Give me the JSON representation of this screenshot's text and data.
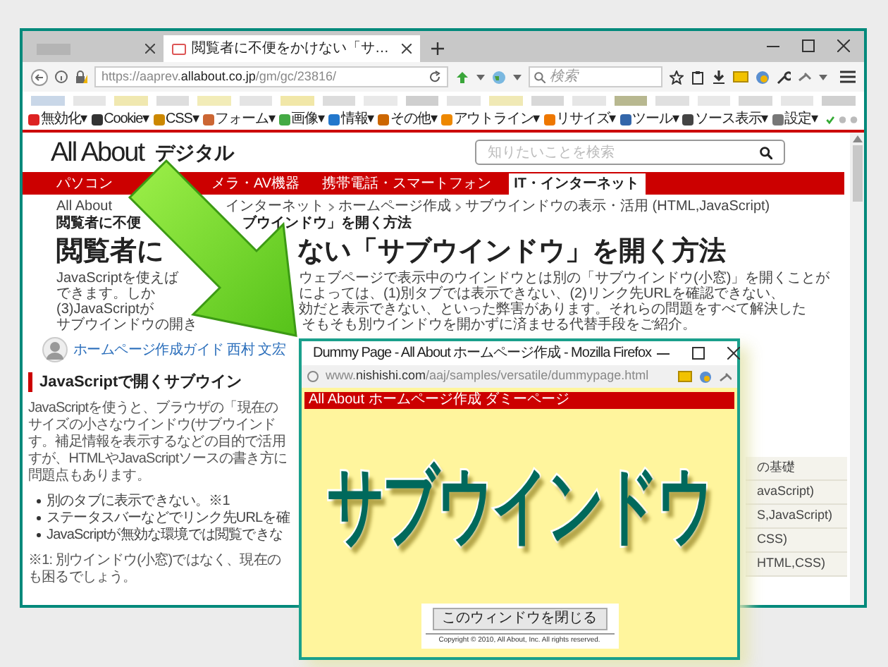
{
  "browser": {
    "tabs": [
      {
        "selected": false
      },
      {
        "title": "閲覧者に不便をかけない「サ…",
        "selected": true
      }
    ],
    "url": "https://aaprev.**allabout.co.jp**/gm/gc/23816/",
    "search_placeholder": "検索",
    "toolbar": [
      "無効化▾",
      "Cookie▾",
      "CSS▾",
      "フォーム▾",
      "画像▾",
      "情報▾",
      "その他▾",
      "アウトライン▾",
      "リサイズ▾",
      "ツール▾",
      "ソース表示▾",
      "設定▾"
    ]
  },
  "page": {
    "logo": "All About",
    "section": "デジタル",
    "search_placeholder": "知りたいことを検索",
    "nav": [
      {
        "label": "パソコン",
        "selected": false
      },
      {
        "label": "メラ・AV機器",
        "selected": false
      },
      {
        "label": "携帯電話・スマートフォン",
        "selected": false
      },
      {
        "label": "IT・インターネット",
        "selected": true
      }
    ],
    "breadcrumb": [
      {
        "current": false,
        "left": [
          "All About"
        ],
        "right": [
          "インターネット",
          "ホームページ作成",
          "サブウインドウの表示・活用 (HTML,JavaScript)"
        ]
      },
      {
        "current": true,
        "left": [
          "閲覧者に不便"
        ],
        "right": [
          "ブウインドウ」を開く方法"
        ]
      }
    ],
    "title": {
      "left": "閲覧者に",
      "right": "ない「サブウインドウ」を開く方法"
    },
    "intro_lines": [
      {
        "left": "JavaScriptを使えば",
        "right": "ウェブページで表示中のウインドウとは別の「サブウインドウ(小窓)」を開くことが"
      },
      {
        "left": "できます。しか",
        "right": "によっては、(1)別タブでは表示できない、(2)リンク先URLを確認できない、"
      },
      {
        "left": "(3)JavaScriptが",
        "right": "効だと表示できない、といった弊害があります。それらの問題をすべて解決した"
      },
      {
        "left": "サブウインドウの開き",
        "right": "そもそも別ウインドウを開かずに済ませる代替手段をご紹介。"
      }
    ],
    "author": "ホームページ作成ガイド 西村 文宏",
    "section_heading": "JavaScriptで開くサブウイン",
    "paragraph_lines": [
      "JavaScriptを使うと、ブラウザの「現在の",
      "サイズの小さなウインドウ(サブウインド",
      "す。補足情報を表示するなどの目的で活用",
      "すが、HTMLやJavaScriptソースの書き方に",
      "問題点もあります。"
    ],
    "bullets": [
      "別のタブに表示できない。※1",
      "ステータスバーなどでリンク先URLを確",
      "JavaScriptが無効な環境では閲覧できな"
    ],
    "footnote_lines": [
      "※1: 別ウインドウ(小窓)ではなく、現在の",
      "も困るでしょう。"
    ],
    "sidebar_fragments": [
      "の基礎",
      "avaScript)",
      "S,JavaScript)",
      "CSS)",
      "HTML,CSS)"
    ]
  },
  "popup": {
    "title": "Dummy Page - All About ホームページ作成 - Mozilla Firefox",
    "url": "www.**nishishi.com**/aaj/samples/versatile/dummypage.html",
    "banner": "All About ホームページ作成 ダミーページ",
    "headline": "サブウインドウ",
    "close_button": "このウィンドウを閉じる",
    "copyright": "Copyright © 2010, All About, Inc. All rights reserved."
  }
}
